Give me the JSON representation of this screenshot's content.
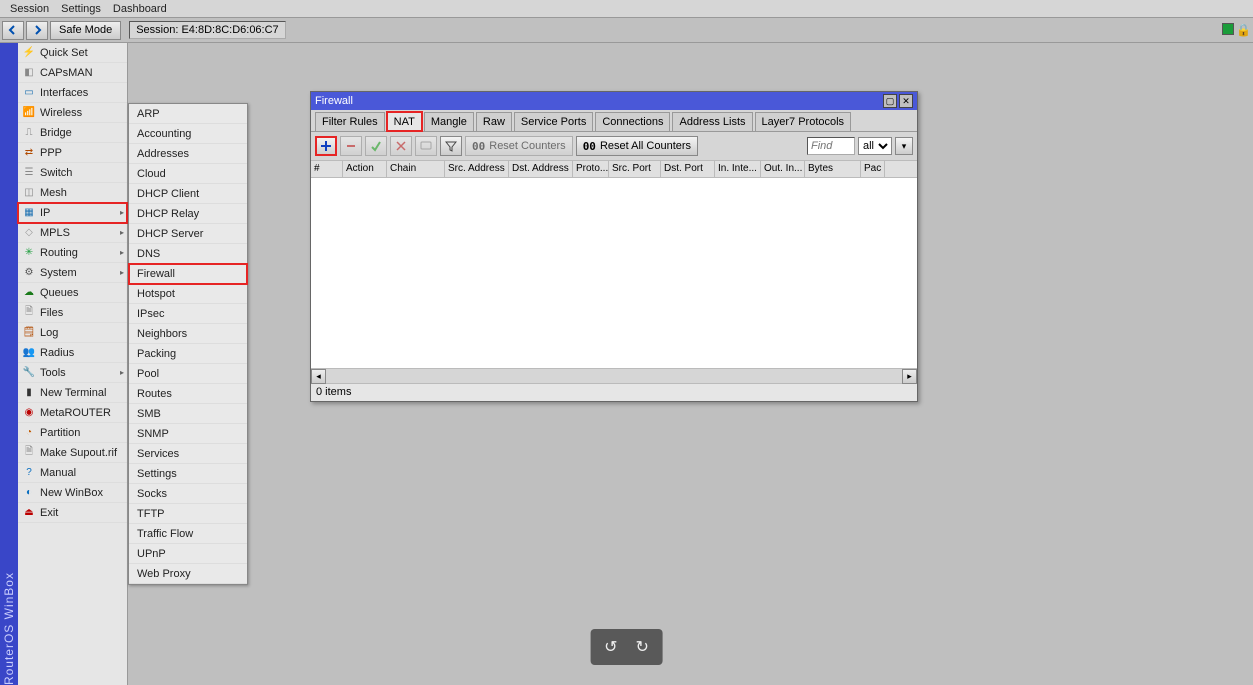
{
  "menubar": [
    "Session",
    "Settings",
    "Dashboard"
  ],
  "toolbar": {
    "safe_mode": "Safe Mode",
    "session_label": "Session: E4:8D:8C:D6:06:C7"
  },
  "vbar_text": "RouterOS WinBox",
  "sidebar": [
    {
      "label": "Quick Set",
      "icon": "⚡",
      "color": "#d08a00"
    },
    {
      "label": "CAPsMAN",
      "icon": "◧",
      "color": "#888"
    },
    {
      "label": "Interfaces",
      "icon": "▭",
      "color": "#1a6fb0"
    },
    {
      "label": "Wireless",
      "icon": "📶",
      "color": "#1a9c3a"
    },
    {
      "label": "Bridge",
      "icon": "⎍",
      "color": "#777"
    },
    {
      "label": "PPP",
      "icon": "⇄",
      "color": "#b04a00"
    },
    {
      "label": "Switch",
      "icon": "☰",
      "color": "#888"
    },
    {
      "label": "Mesh",
      "icon": "◫",
      "color": "#888"
    },
    {
      "label": "IP",
      "icon": "▦",
      "color": "#1a6fb0",
      "arrow": true,
      "highlight": true
    },
    {
      "label": "MPLS",
      "icon": "◇",
      "color": "#999",
      "arrow": true
    },
    {
      "label": "Routing",
      "icon": "✳",
      "color": "#1a9c3a",
      "arrow": true
    },
    {
      "label": "System",
      "icon": "⚙",
      "color": "#555",
      "arrow": true
    },
    {
      "label": "Queues",
      "icon": "☁",
      "color": "#1a7a1a"
    },
    {
      "label": "Files",
      "icon": "🗎",
      "color": "#888"
    },
    {
      "label": "Log",
      "icon": "🗒",
      "color": "#b04a00"
    },
    {
      "label": "Radius",
      "icon": "👥",
      "color": "#c05a00"
    },
    {
      "label": "Tools",
      "icon": "🔧",
      "color": "#555",
      "arrow": true
    },
    {
      "label": "New Terminal",
      "icon": "▮",
      "color": "#333"
    },
    {
      "label": "MetaROUTER",
      "icon": "◉",
      "color": "#b00"
    },
    {
      "label": "Partition",
      "icon": "◔",
      "color": "#c05a00"
    },
    {
      "label": "Make Supout.rif",
      "icon": "🗎",
      "color": "#888"
    },
    {
      "label": "Manual",
      "icon": "?",
      "color": "#0a6fc0"
    },
    {
      "label": "New WinBox",
      "icon": "◐",
      "color": "#0a6fc0"
    },
    {
      "label": "Exit",
      "icon": "⏏",
      "color": "#b00"
    }
  ],
  "submenu": [
    "ARP",
    "Accounting",
    "Addresses",
    "Cloud",
    "DHCP Client",
    "DHCP Relay",
    "DHCP Server",
    "DNS",
    {
      "label": "Firewall",
      "highlight": true
    },
    "Hotspot",
    "IPsec",
    "Neighbors",
    "Packing",
    "Pool",
    "Routes",
    "SMB",
    "SNMP",
    "Services",
    "Settings",
    "Socks",
    "TFTP",
    "Traffic Flow",
    "UPnP",
    "Web Proxy"
  ],
  "firewall": {
    "title": "Firewall",
    "tabs": [
      "Filter Rules",
      "NAT",
      "Mangle",
      "Raw",
      "Service Ports",
      "Connections",
      "Address Lists",
      "Layer7 Protocols"
    ],
    "active_tab": "NAT",
    "highlight_tab": "NAT",
    "reset_counters": "Reset Counters",
    "reset_all_counters": "Reset All Counters",
    "find_placeholder": "Find",
    "filter_all": "all",
    "columns": [
      {
        "label": "#",
        "w": 32
      },
      {
        "label": "Action",
        "w": 44
      },
      {
        "label": "Chain",
        "w": 58
      },
      {
        "label": "Src. Address",
        "w": 64
      },
      {
        "label": "Dst. Address",
        "w": 64
      },
      {
        "label": "Proto...",
        "w": 36
      },
      {
        "label": "Src. Port",
        "w": 52
      },
      {
        "label": "Dst. Port",
        "w": 54
      },
      {
        "label": "In. Inte...",
        "w": 46
      },
      {
        "label": "Out. In...",
        "w": 44
      },
      {
        "label": "Bytes",
        "w": 56
      },
      {
        "label": "Pac",
        "w": 24
      }
    ],
    "status": "0 items"
  }
}
